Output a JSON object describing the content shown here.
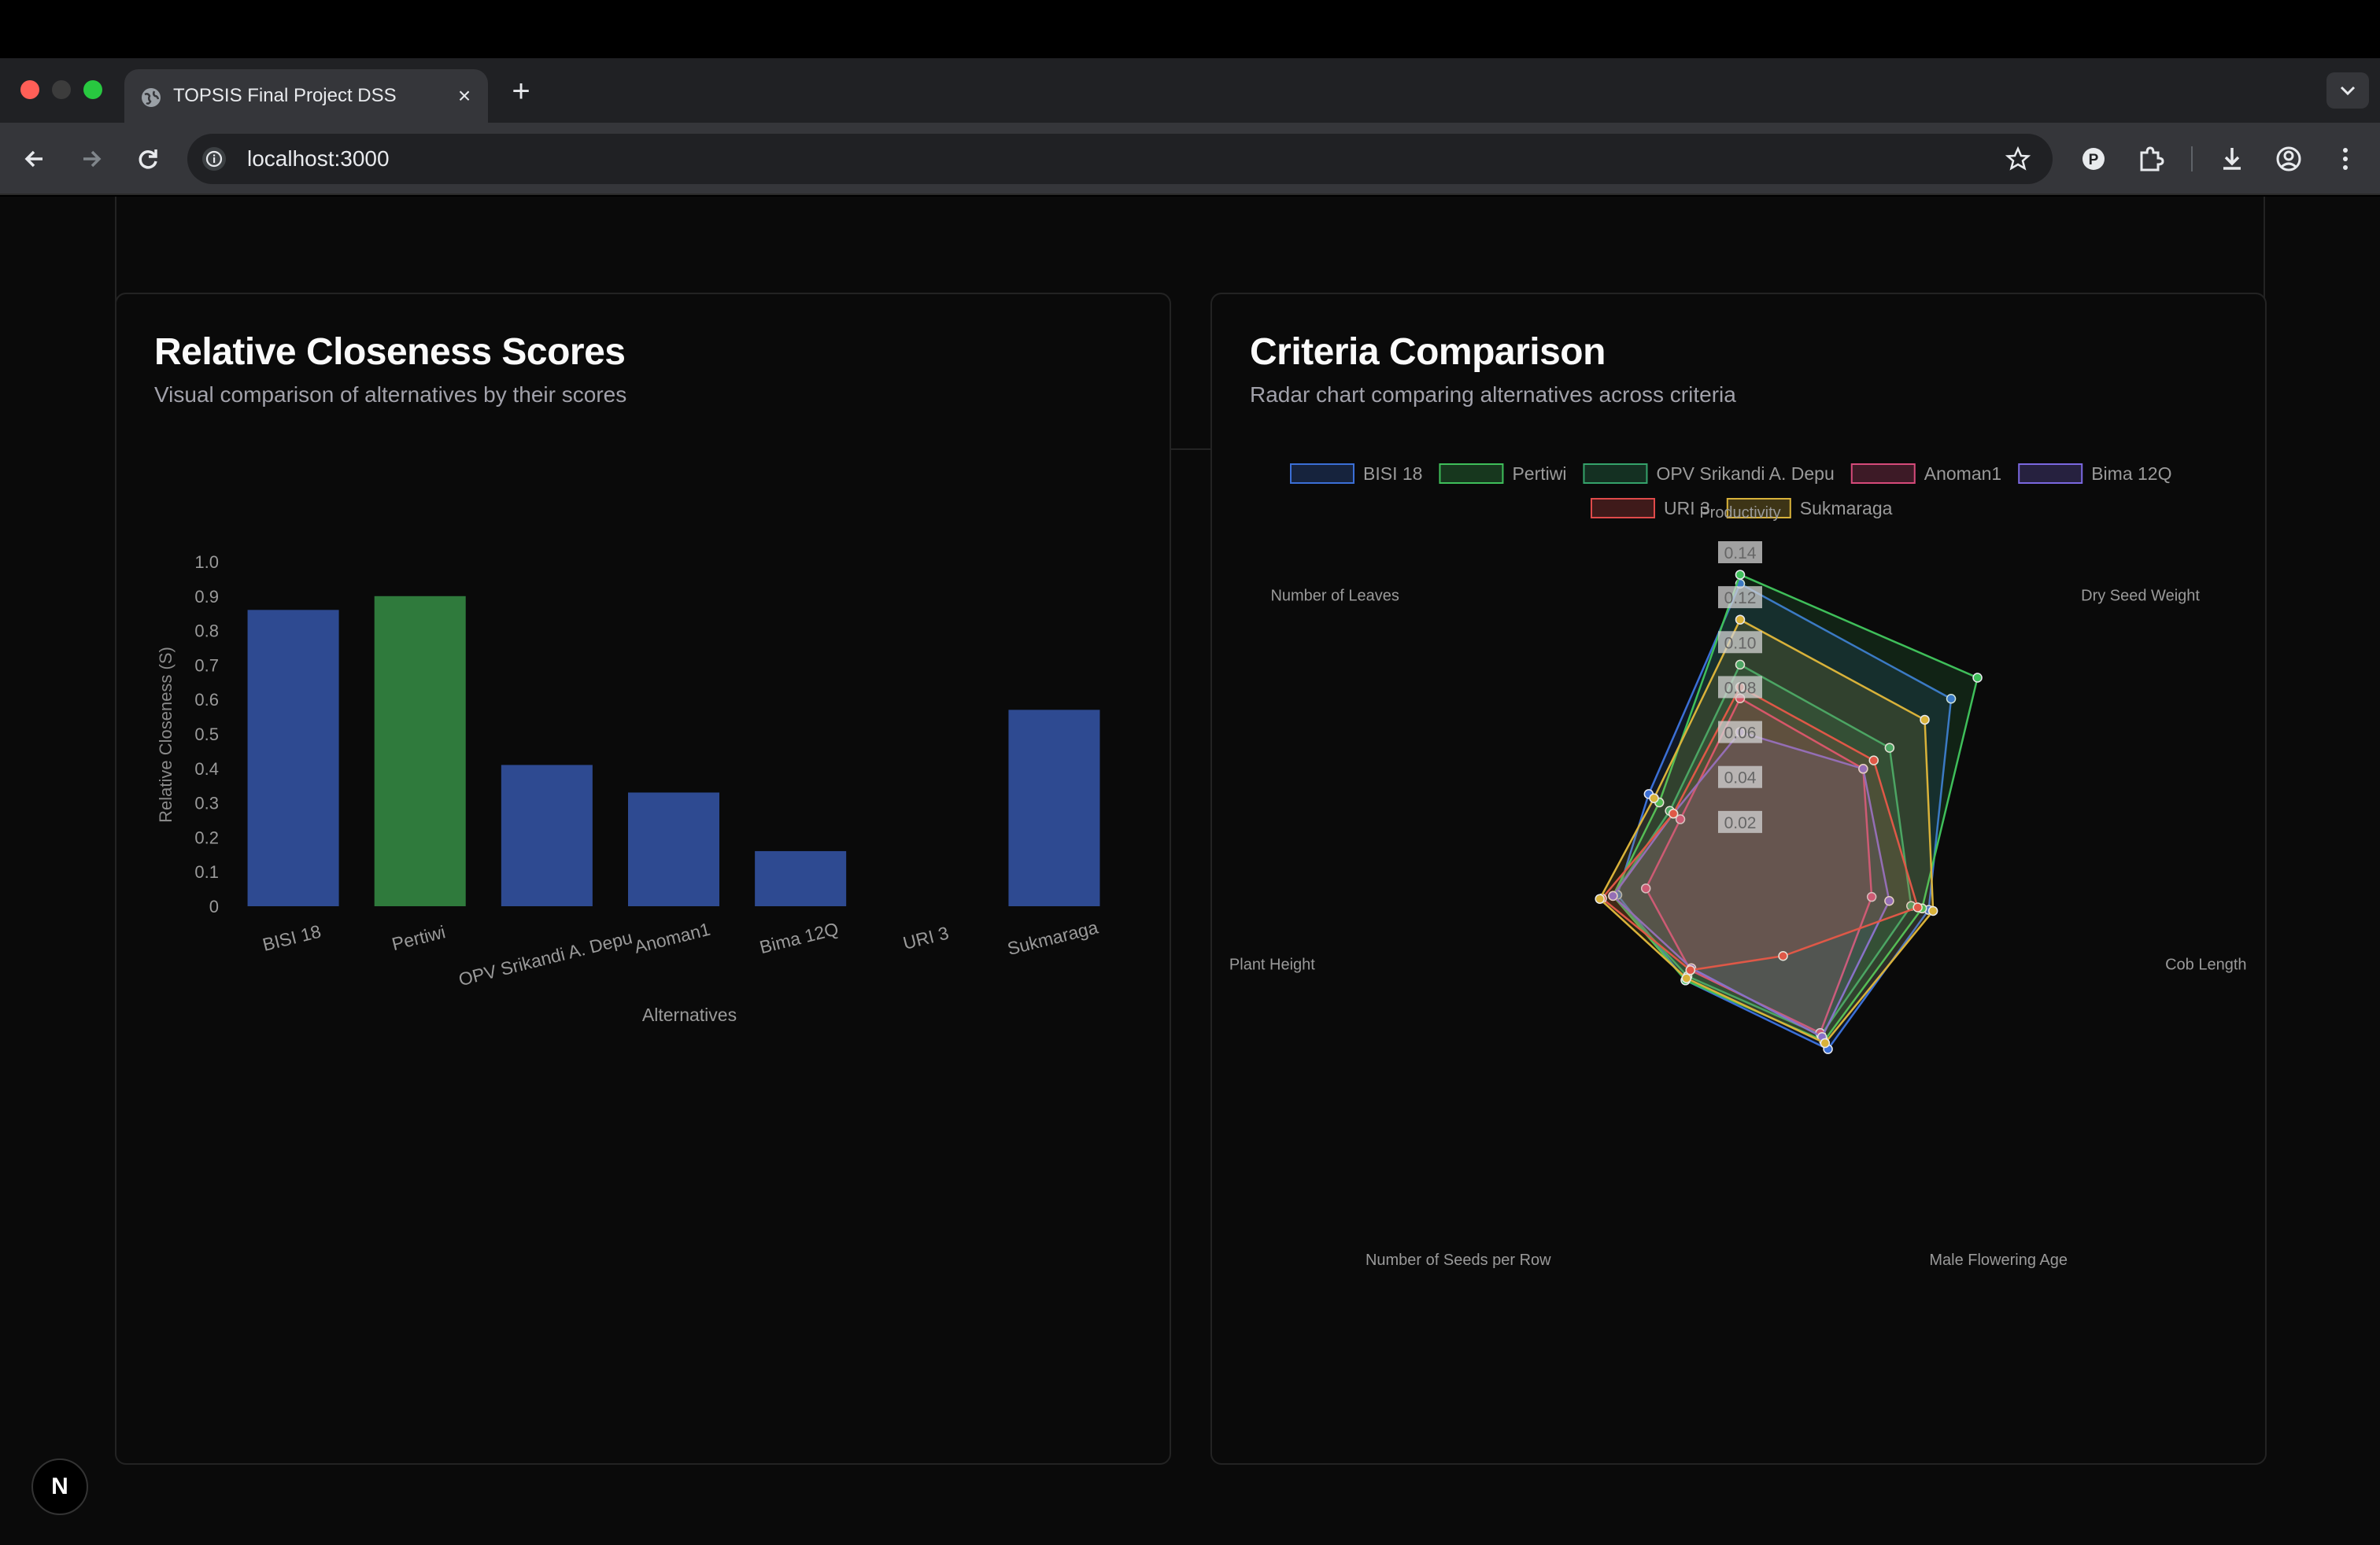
{
  "browser": {
    "tab_title": "TOPSIS Final Project DSS",
    "url": "localhost:3000"
  },
  "bar_card": {
    "title": "Relative Closeness Scores",
    "subtitle": "Visual comparison of alternatives by their scores"
  },
  "radar_card": {
    "title": "Criteria Comparison",
    "subtitle": "Radar chart comparing alternatives across criteria"
  },
  "colors": {
    "bar_default": "#2e4a91",
    "bar_best": "#2f7a3c"
  },
  "chart_data": [
    {
      "type": "bar",
      "categories": [
        "BISI 18",
        "Pertiwi",
        "OPV Srikandi A. Depu",
        "Anoman1",
        "Bima 12Q",
        "URI 3",
        "Sukmaraga"
      ],
      "values": [
        0.86,
        0.9,
        0.41,
        0.33,
        0.16,
        0,
        0.57
      ],
      "highlight_index": 1,
      "xlabel": "Alternatives",
      "ylabel": "Relative Closeness (S)",
      "ylim": [
        0,
        1
      ],
      "yticks": [
        "0",
        "0.1",
        "0.2",
        "0.3",
        "0.4",
        "0.5",
        "0.6",
        "0.7",
        "0.8",
        "0.9",
        "1.0"
      ],
      "grid": false
    },
    {
      "type": "radar",
      "axes": [
        "Productivity",
        "Dry Seed Weight",
        "Cob Length",
        "Male Flowering Age",
        "Number of Seeds per Row",
        "Plant Height",
        "Number of Leaves"
      ],
      "rlim": [
        0,
        0.14
      ],
      "rticks": [
        "0.02",
        "0.04",
        "0.06",
        "0.08",
        "0.10",
        "0.12",
        "0.14"
      ],
      "legend_position": "top",
      "series": [
        {
          "name": "BISI 18",
          "color": "#3b6fd6",
          "values": [
            0.126,
            0.12,
            0.086,
            0.09,
            0.056,
            0.056,
            0.052
          ]
        },
        {
          "name": "Pertiwi",
          "color": "#3fbf5a",
          "values": [
            0.13,
            0.135,
            0.083,
            0.086,
            0.056,
            0.058,
            0.046
          ]
        },
        {
          "name": "OPV Srikandi A. Depu",
          "color": "#35a36b",
          "values": [
            0.09,
            0.085,
            0.078,
            0.083,
            0.054,
            0.058,
            0.04
          ]
        },
        {
          "name": "Anoman1",
          "color": "#d64a7a",
          "values": [
            0.075,
            0.07,
            0.06,
            0.082,
            0.051,
            0.043,
            0.034
          ]
        },
        {
          "name": "Bima 12Q",
          "color": "#7b68e0",
          "values": [
            0.06,
            0.07,
            0.068,
            0.084,
            0.05,
            0.058,
            0.038
          ]
        },
        {
          "name": "URI 3",
          "color": "#e04a4a",
          "values": [
            0.08,
            0.076,
            0.081,
            0.044,
            0.051,
            0.063,
            0.038
          ]
        },
        {
          "name": "Sukmaraga",
          "color": "#d9b23a",
          "values": [
            0.11,
            0.105,
            0.088,
            0.087,
            0.055,
            0.064,
            0.049
          ]
        }
      ]
    }
  ]
}
